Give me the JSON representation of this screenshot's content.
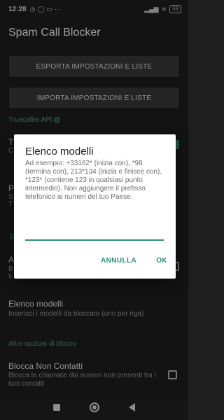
{
  "status_bar": {
    "time": "12:28",
    "left_icons": [
      "clock-icon",
      "whatsapp-icon",
      "messages-icon",
      "more-icon"
    ],
    "battery": "59"
  },
  "app_bar": {
    "title": "Spam Call Blocker"
  },
  "settings": {
    "export_button": "ESPORTA IMPOSTAZIONI E LISTE",
    "import_button": "IMPORTA IMPOSTAZIONI E LISTE",
    "truecaller_header": "Truecaller API",
    "partial_1": "T",
    "partial_1b": "C",
    "partial_2": "P",
    "partial_2b": "S",
    "partial_2c": "T",
    "partial_3": "E",
    "partial_4": "A",
    "partial_4b": "B",
    "partial_4c": "s",
    "patterns_title": "Elenco modelli",
    "patterns_summary": "Inserisci i modelli da bloccare (uno per riga)",
    "other_header": "Altre opzioni di blocco",
    "block_non_contacts_title": "Blocca Non Contatti",
    "block_non_contacts_summary": "Blocca le chiamate dai numeri non presenti tra i tuoi contatti"
  },
  "dialog": {
    "title": "Elenco modelli",
    "message": "Ad esempio: +33162* (inizia con), *98 (termina con), 213*134 (inizia e finisce con), *123* (contiene 123 in qualsiasi punto intermedio). Non aggiungere il prefisso telefonico ai numeri del tuo Paese.",
    "input_value": "",
    "cancel": "ANNULLA",
    "ok": "OK"
  },
  "colors": {
    "accent": "#2f8f78",
    "section_header": "#4f9f88",
    "background": "#1f1f1f"
  }
}
